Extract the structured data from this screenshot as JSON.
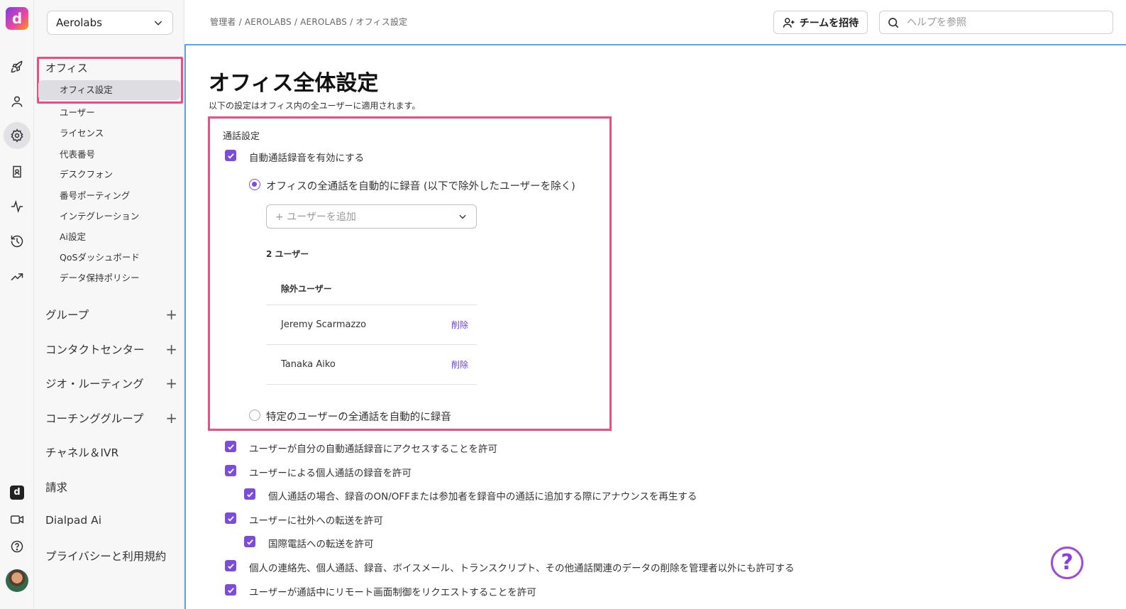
{
  "rail": {
    "logo_letter": "d",
    "icons": [
      "rocket-icon",
      "user-icon",
      "gear-icon",
      "contacts-icon",
      "activity-icon",
      "history-icon",
      "trending-icon"
    ],
    "bottom_icons": [
      "dialpad-app-icon",
      "video-icon",
      "help-icon"
    ]
  },
  "sidebar": {
    "org_name": "Aerolabs",
    "office_section": "オフィス",
    "office_items": [
      {
        "label": "オフィス設定",
        "active": true
      },
      {
        "label": "ユーザー"
      },
      {
        "label": "ライセンス"
      },
      {
        "label": "代表番号"
      },
      {
        "label": "デスクフォン"
      },
      {
        "label": "番号ポーティング"
      },
      {
        "label": "インテグレーション"
      },
      {
        "label": "Ai設定"
      },
      {
        "label": "QoSダッシュボード"
      },
      {
        "label": "データ保持ポリシー"
      }
    ],
    "groups": [
      {
        "label": "グループ",
        "expandable": true
      },
      {
        "label": "コンタクトセンター",
        "expandable": true
      },
      {
        "label": "ジオ・ルーティング",
        "expandable": true
      },
      {
        "label": "コーチンググループ",
        "expandable": true
      },
      {
        "label": "チャネル＆IVR",
        "expandable": false
      },
      {
        "label": "請求",
        "expandable": false
      },
      {
        "label": "Dialpad Ai",
        "expandable": false
      },
      {
        "label": "プライバシーと利用規約",
        "expandable": false
      }
    ]
  },
  "topbar": {
    "breadcrumb": "管理者 / AEROLABS / AEROLABS / オフィス設定",
    "invite_label": "チームを招待",
    "search_placeholder": "ヘルプを参照"
  },
  "main": {
    "title": "オフィス全体設定",
    "description": "以下の設定はオフィス内の全ユーザーに適用されます。",
    "call_settings": {
      "section_label": "通話設定",
      "auto_record_label": "自動通話録音を有効にする",
      "radio_all_label": "オフィスの全通話を自動的に録音 (以下で除外したユーザーを除く)",
      "add_user_placeholder": "+ ユーザーを追加",
      "user_count": "2 ユーザー",
      "excluded_header": "除外ユーザー",
      "excluded_users": [
        {
          "name": "Jeremy Scarmazzo",
          "action": "削除"
        },
        {
          "name": "Tanaka Aiko",
          "action": "削除"
        }
      ],
      "radio_specific_label": "特定のユーザーの全通話を自動的に録音"
    },
    "other_settings": [
      "ユーザーが自分の自動通話録音にアクセスすることを許可",
      "ユーザーによる個人通話の録音を許可",
      "個人通話の場合、録音のON/OFFまたは参加者を録音中の通話に追加する際にアナウンスを再生する",
      "ユーザーに社外への転送を許可",
      "国際電話への転送を許可",
      "個人の連絡先、個人通話、録音、ボイスメール、トランスクリプト、その他通話関連のデータの削除を管理者以外にも許可する",
      "ユーザーが通話中にリモート画面制御をリクエストすることを許可"
    ]
  },
  "help_fab": "?",
  "colors": {
    "accent": "#7c4ddc",
    "highlight_border": "#ec4d85",
    "focus_border": "#5aa6e6"
  }
}
